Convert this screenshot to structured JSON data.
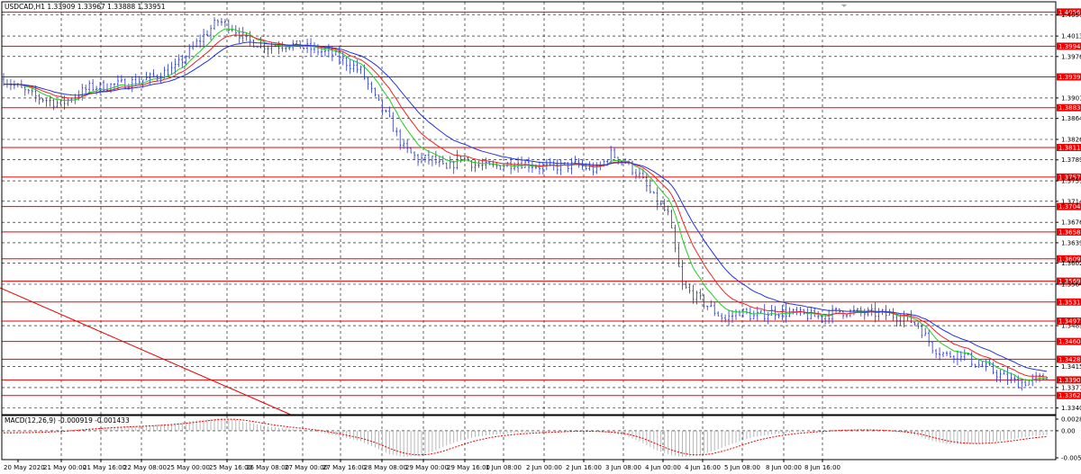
{
  "header": {
    "symbol_line": "USDCAD,H1  1.33909 1.33967 1.33888 1.33951",
    "macd_label": "MACD(12,26,9) -0.000919 -0.001433"
  },
  "chart_data": {
    "type": "candlestick",
    "symbol": "USDCAD",
    "timeframe": "H1",
    "last_bar": {
      "open": 1.33909,
      "high": 1.33967,
      "low": 1.33888,
      "close": 1.33951
    },
    "ylim": [
      1.3328,
      1.4075
    ],
    "y_ticks": [
      "1.40510",
      "1.40130",
      "1.39760",
      "1.39010",
      "1.38640",
      "1.38260",
      "1.37890",
      "1.37510",
      "1.37140",
      "1.36760",
      "1.36390",
      "1.36020",
      "1.35640",
      "1.34890",
      "1.34150",
      "1.33770",
      "1.33400"
    ],
    "x_ticks": [
      "20 May 2020",
      "21 May 00:00",
      "21 May 16:00",
      "22 May 08:00",
      "25 May 00:00",
      "25 May 16:00",
      "26 May 08:00",
      "27 May 00:00",
      "27 May 16:00",
      "28 May 08:00",
      "29 May 00:00",
      "29 May 16:00",
      "1 Jun 08:00",
      "2 Jun 00:00",
      "2 Jun 16:00",
      "3 Jun 08:00",
      "4 Jun 00:00",
      "4 Jun 16:00",
      "5 Jun 08:00",
      "8 Jun 00:00",
      "8 Jun 16:00"
    ],
    "levels": [
      "1.40565",
      "1.39946",
      "1.39391",
      "1.38834",
      "1.38114",
      "1.37579",
      "1.37045",
      "1.36585",
      "1.36099",
      "1.35695",
      "1.35318",
      "1.34973",
      "1.34604",
      "1.34282",
      "1.33908",
      "1.33626"
    ],
    "price_path": [
      [
        0,
        1.3935
      ],
      [
        8,
        1.3905
      ],
      [
        16,
        1.389
      ],
      [
        24,
        1.392
      ],
      [
        32,
        1.3925
      ],
      [
        40,
        1.3935
      ],
      [
        48,
        1.3955
      ],
      [
        54,
        1.4
      ],
      [
        60,
        1.404
      ],
      [
        64,
        1.403
      ],
      [
        68,
        1.4005
      ],
      [
        74,
        1.3995
      ],
      [
        80,
        1.3998
      ],
      [
        86,
        1.399
      ],
      [
        92,
        1.398
      ],
      [
        100,
        1.395
      ],
      [
        104,
        1.39
      ],
      [
        108,
        1.386
      ],
      [
        112,
        1.381
      ],
      [
        116,
        1.379
      ],
      [
        120,
        1.379
      ],
      [
        124,
        1.377
      ],
      [
        128,
        1.3795
      ],
      [
        132,
        1.378
      ],
      [
        136,
        1.3775
      ],
      [
        144,
        1.3785
      ],
      [
        152,
        1.3775
      ],
      [
        160,
        1.378
      ],
      [
        166,
        1.377
      ],
      [
        170,
        1.38
      ],
      [
        174,
        1.3785
      ],
      [
        178,
        1.376
      ],
      [
        182,
        1.372
      ],
      [
        186,
        1.369
      ],
      [
        190,
        1.356
      ],
      [
        194,
        1.354
      ],
      [
        198,
        1.352
      ],
      [
        202,
        1.35
      ],
      [
        206,
        1.3515
      ],
      [
        210,
        1.3505
      ],
      [
        216,
        1.3515
      ],
      [
        222,
        1.351
      ],
      [
        228,
        1.3505
      ],
      [
        234,
        1.3515
      ],
      [
        240,
        1.3512
      ],
      [
        246,
        1.351
      ],
      [
        252,
        1.3505
      ],
      [
        256,
        1.349
      ],
      [
        260,
        1.345
      ],
      [
        264,
        1.3435
      ],
      [
        268,
        1.344
      ],
      [
        272,
        1.342
      ],
      [
        276,
        1.341
      ],
      [
        280,
        1.3395
      ],
      [
        284,
        1.3385
      ],
      [
        288,
        1.339
      ],
      [
        292,
        1.3395
      ]
    ],
    "macd_range": [
      -0.0055,
      0.0029
    ],
    "macd_ticks": [
      "0.002876",
      "0.00",
      "-0.00554"
    ],
    "macd_histogram": [
      [
        0,
        -0.0004
      ],
      [
        8,
        -0.0003
      ],
      [
        16,
        0.0
      ],
      [
        24,
        0.0005
      ],
      [
        32,
        0.0008
      ],
      [
        40,
        0.001
      ],
      [
        48,
        0.0014
      ],
      [
        54,
        0.002
      ],
      [
        60,
        0.0024
      ],
      [
        64,
        0.0022
      ],
      [
        68,
        0.0016
      ],
      [
        74,
        0.0008
      ],
      [
        80,
        0.0004
      ],
      [
        86,
        0.0
      ],
      [
        92,
        -0.0008
      ],
      [
        100,
        -0.002
      ],
      [
        104,
        -0.0032
      ],
      [
        108,
        -0.0045
      ],
      [
        112,
        -0.005
      ],
      [
        116,
        -0.0048
      ],
      [
        120,
        -0.004
      ],
      [
        124,
        -0.0028
      ],
      [
        128,
        -0.0018
      ],
      [
        132,
        -0.0012
      ],
      [
        136,
        -0.0008
      ],
      [
        144,
        -0.0004
      ],
      [
        152,
        -0.0002
      ],
      [
        160,
        0.0
      ],
      [
        166,
        -0.0002
      ],
      [
        170,
        -0.0004
      ],
      [
        174,
        -0.001
      ],
      [
        178,
        -0.002
      ],
      [
        182,
        -0.0035
      ],
      [
        186,
        -0.0045
      ],
      [
        190,
        -0.005
      ],
      [
        194,
        -0.0048
      ],
      [
        198,
        -0.004
      ],
      [
        202,
        -0.003
      ],
      [
        206,
        -0.002
      ],
      [
        210,
        -0.0012
      ],
      [
        216,
        -0.0006
      ],
      [
        222,
        -0.0002
      ],
      [
        228,
        0.0
      ],
      [
        234,
        0.0002
      ],
      [
        240,
        0.0002
      ],
      [
        246,
        0.0
      ],
      [
        252,
        -0.0004
      ],
      [
        256,
        -0.001
      ],
      [
        260,
        -0.002
      ],
      [
        264,
        -0.0025
      ],
      [
        268,
        -0.0026
      ],
      [
        272,
        -0.0025
      ],
      [
        276,
        -0.0022
      ],
      [
        280,
        -0.0018
      ],
      [
        284,
        -0.0014
      ],
      [
        288,
        -0.001
      ],
      [
        292,
        -0.0009
      ]
    ],
    "colors": {
      "candles": "#2233cc",
      "ma_fast": "#22cc22",
      "ma_mid": "#ee2222",
      "ma_slow": "#2233dd",
      "levels": "#ee0000",
      "grid": "#000000",
      "macd_signal": "#ee0000",
      "macd_hist": "#b0b0b0",
      "level_label_bg": "#ee0000",
      "level_label_text": "#ffffff"
    }
  }
}
